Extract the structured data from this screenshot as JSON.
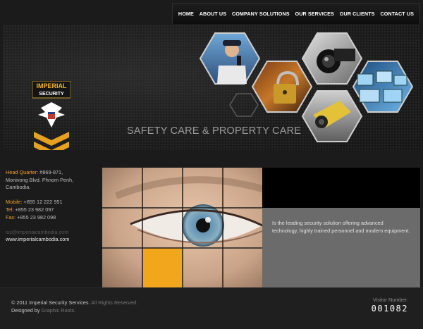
{
  "nav": {
    "items": [
      "HOME",
      "ABOUT US",
      "COMPANY SOLUTIONS",
      "OUR SERVICES",
      "OUR CLIENTS",
      "CONTACT US"
    ]
  },
  "hero": {
    "logo_line1": "IMPERIAL",
    "logo_line2": "SECURITY",
    "tagline": "SAFETY CARE & PROPERTY CARE",
    "images": [
      "security-guard-photo",
      "padlock-photo",
      "cctv-camera-photo",
      "monitoring-screens-photo",
      "camera-dome-photo"
    ]
  },
  "contact": {
    "hq_label": "Head Quarter:",
    "hq_value": " #869-871,",
    "hq_line2": "Monivong Blvd. Phnom Penh,",
    "hq_line3": "Cambodia.",
    "mobile_label": "Mobile:",
    "mobile_value": " +855 12 222 951",
    "tel_label": "Tel:",
    "tel_value": " +855 23 982 097",
    "fax_label": "Fax:",
    "fax_value": " +855 23 982 098",
    "email": "iss@imperialcambodia.com",
    "website": "www.imperialcambodia.com"
  },
  "intro": {
    "text": "Is the leading security solution offering advanced technology, highly trained personnel and modern equipment."
  },
  "footer": {
    "copyright": "© 2011 Imperial Security Services.",
    "rights": " All Rights Reserved.",
    "designed_by": "Designed by",
    "designer": " Graphic Roots.",
    "visitor_label": "Visitor Number:",
    "visitor_count": "001082"
  },
  "colors": {
    "accent": "#f2a61c",
    "background": "#1b1b1b",
    "panel_gray": "#6b6b6b"
  }
}
